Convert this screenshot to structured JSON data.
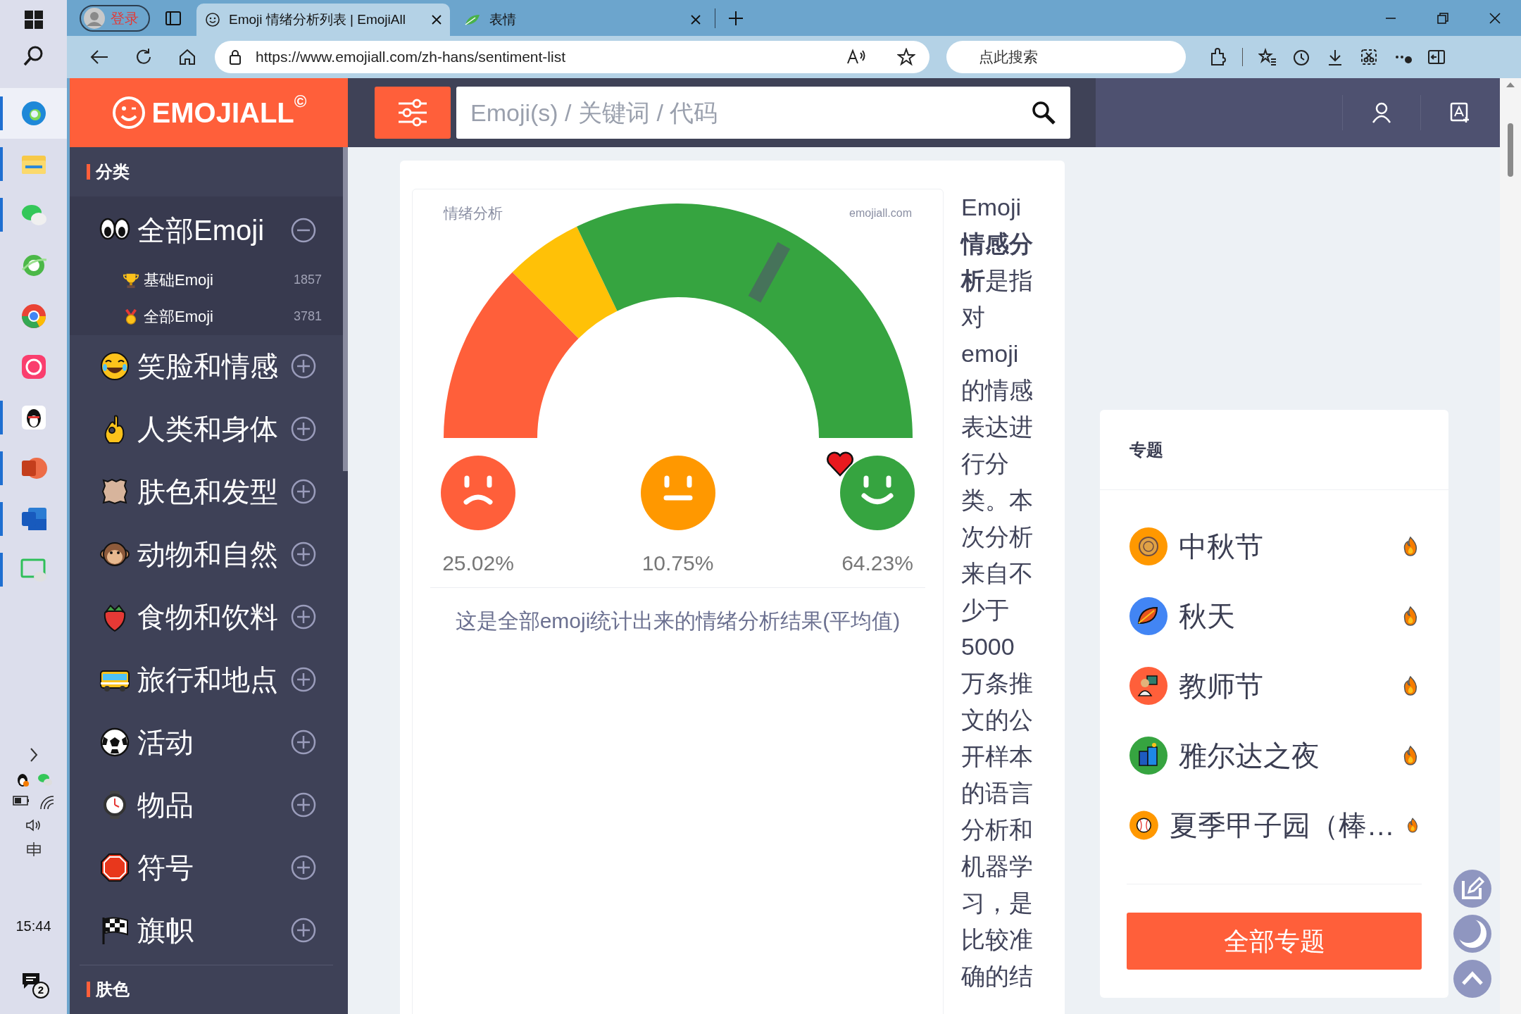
{
  "taskbar": {
    "apps": [
      {
        "running": true,
        "selected": true
      },
      {
        "running": true,
        "selected": false
      },
      {
        "running": true,
        "selected": false
      },
      {
        "running": false,
        "selected": false
      },
      {
        "running": false,
        "selected": false
      },
      {
        "running": false,
        "selected": false
      },
      {
        "running": true,
        "selected": false
      },
      {
        "running": true,
        "selected": false
      },
      {
        "running": true,
        "selected": false
      },
      {
        "running": true,
        "selected": false
      }
    ],
    "clock": "15:44",
    "notification_count": "2"
  },
  "browser": {
    "profile_label": "登录",
    "tabs": [
      {
        "title": "Emoji 情绪分析列表 | EmojiAll",
        "selected": true
      },
      {
        "title": "表情",
        "selected": false
      }
    ],
    "url": "https://www.emojiall.com/zh-hans/sentiment-list",
    "search_placeholder": "点此搜索"
  },
  "site": {
    "logo": "EMOJIALL",
    "logo_mark": "©",
    "search_placeholder": "Emoji(s) / 关键词 / 代码"
  },
  "sidebar": {
    "heading": "分类",
    "categories": [
      {
        "label": "全部Emoji",
        "expanded": true,
        "children": [
          {
            "label": "基础Emoji",
            "count": "1857"
          },
          {
            "label": "全部Emoji",
            "count": "3781"
          }
        ]
      },
      {
        "label": "笑脸和情感",
        "expanded": false
      },
      {
        "label": "人类和身体",
        "expanded": false
      },
      {
        "label": "肤色和发型",
        "expanded": false
      },
      {
        "label": "动物和自然",
        "expanded": false
      },
      {
        "label": "食物和饮料",
        "expanded": false
      },
      {
        "label": "旅行和地点",
        "expanded": false
      },
      {
        "label": "活动",
        "expanded": false
      },
      {
        "label": "物品",
        "expanded": false
      },
      {
        "label": "符号",
        "expanded": false
      },
      {
        "label": "旗帜",
        "expanded": false
      }
    ],
    "next_heading": "肤色"
  },
  "sentiment": {
    "title": "情绪分析",
    "site_label": "emojiall.com",
    "segments": [
      {
        "kind": "negative",
        "percent": "25.02%",
        "color": "#ff5f3a"
      },
      {
        "kind": "neutral",
        "percent": "10.75%",
        "color": "#ffc107"
      },
      {
        "kind": "positive",
        "percent": "64.23%",
        "color": "#36a440"
      }
    ],
    "marker": {
      "level": 0.66
    },
    "caption": "这是全部emoji统计出来的情绪分析结果(平均值)"
  },
  "intro": "Emoji **情感分析**是指对 emoji 的情感表达进行分类。本次分析来自不少于 5000 万条推文的公开样本的语言分析和机器学习，是比较准确的结",
  "topics": {
    "title": "专题",
    "items": [
      {
        "label": "中秋节",
        "color": "#ff9800"
      },
      {
        "label": "秋天",
        "color": "#4285f4"
      },
      {
        "label": "教师节",
        "color": "#ff5f3a"
      },
      {
        "label": "雅尔达之夜",
        "color": "#36a440"
      },
      {
        "label": "夏季甲子园（棒…",
        "color": "#ff9800"
      }
    ],
    "button": "全部专题"
  }
}
